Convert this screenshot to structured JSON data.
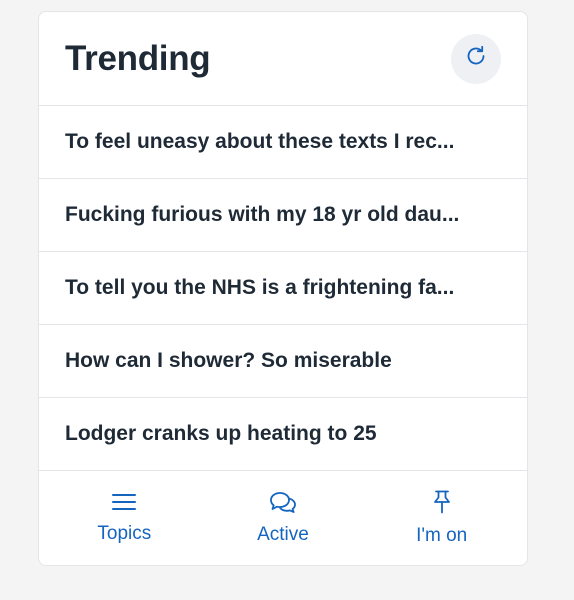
{
  "header": {
    "title": "Trending",
    "refresh_icon": "refresh-icon"
  },
  "trending": [
    {
      "title": "To feel uneasy about these texts I rec..."
    },
    {
      "title": "Fucking furious with my 18 yr old dau..."
    },
    {
      "title": "To tell you the NHS is a frightening fa..."
    },
    {
      "title": "How can I shower? So miserable"
    },
    {
      "title": "Lodger cranks up heating to 25"
    }
  ],
  "nav": {
    "items": [
      {
        "label": "Topics",
        "icon": "menu-icon"
      },
      {
        "label": "Active",
        "icon": "chat-bubbles-icon"
      },
      {
        "label": "I'm on",
        "icon": "pin-icon"
      }
    ]
  },
  "colors": {
    "accent": "#1565c0",
    "text": "#1f2a37",
    "divider": "#e3e5e8",
    "background": "#f4f4f5"
  }
}
